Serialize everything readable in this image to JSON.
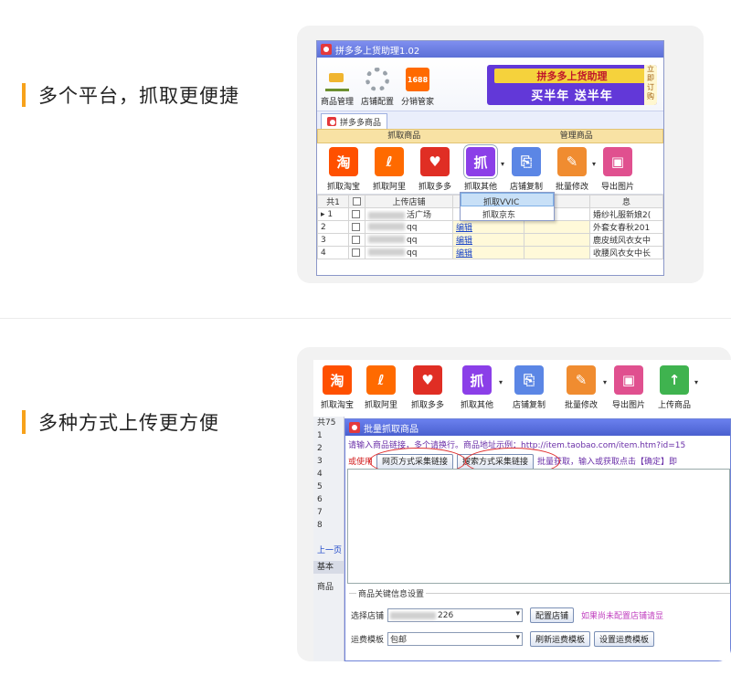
{
  "features": [
    {
      "text": "多个平台，抓取更便捷"
    },
    {
      "text": "多种方式上传更方便"
    }
  ],
  "window1": {
    "title": "拼多多上货助理1.02",
    "menu": [
      "商品管理",
      "店铺配置",
      "分销管家"
    ],
    "icon_1688": "1688",
    "banner": {
      "top": "拼多多上货助理",
      "bottom": "买半年  送半年",
      "side": "立即订购"
    },
    "tab": "拼多多商品",
    "groups": [
      "抓取商品",
      "管理商品"
    ],
    "ribbon": [
      {
        "label": "抓取淘宝",
        "glyph": "淘"
      },
      {
        "label": "抓取阿里",
        "glyph": "ℓ"
      },
      {
        "label": "抓取多多",
        "glyph": "♥"
      },
      {
        "label": "抓取其他",
        "glyph": "抓"
      },
      {
        "label": "店铺复制",
        "glyph": "⎘"
      },
      {
        "label": "批量修改",
        "glyph": "✎"
      },
      {
        "label": "导出图片",
        "glyph": "▣"
      }
    ],
    "dropdown": [
      "抓取VVIC",
      "抓取京东"
    ],
    "table": {
      "head": [
        "共1",
        "",
        "上传店铺",
        "",
        "",
        "息"
      ],
      "rows": [
        {
          "n": "1",
          "shop": "活广场",
          "edit": "",
          "title": "婚纱礼服新娘2("
        },
        {
          "n": "2",
          "shop": "qq",
          "edit": "编辑",
          "title": "外套女春秋201"
        },
        {
          "n": "3",
          "shop": "qq",
          "edit": "编辑",
          "title": "鹿皮绒风衣女中"
        },
        {
          "n": "4",
          "shop": "qq",
          "edit": "编辑",
          "title": "收腰风衣女中长"
        }
      ]
    }
  },
  "window2": {
    "ribbon": [
      {
        "label": "抓取淘宝",
        "glyph": "淘"
      },
      {
        "label": "抓取阿里",
        "glyph": "ℓ"
      },
      {
        "label": "抓取多多",
        "glyph": "♥"
      },
      {
        "label": "抓取其他",
        "glyph": "抓"
      },
      {
        "label": "店铺复制",
        "glyph": "⎘"
      },
      {
        "label": "批量修改",
        "glyph": "✎"
      },
      {
        "label": "导出图片",
        "glyph": "▣"
      },
      {
        "label": "上传商品",
        "glyph": "↑"
      }
    ],
    "side": [
      "共75",
      "1",
      "2",
      "3",
      "4",
      "5",
      "6",
      "7",
      "8"
    ],
    "side_prev": "上一页",
    "side_basic": "基本",
    "side_goods": "商品",
    "dialog": {
      "title": "批量抓取商品",
      "hint1": "请输入商品链接，多个请换行。商品地址示例：http://item.taobao.com/item.htm?id=15",
      "hint2_pre": "或使用",
      "btn_web": "网页方式采集链接",
      "btn_search": "搜索方式采集链接",
      "hint2_post": "批量获取，输入或获取点击【确定】即",
      "section": "商品关键信息设置",
      "shop_label": "选择店铺",
      "shop_value": "226",
      "config_btn": "配置店铺",
      "config_tip": "如果尚未配置店铺请显",
      "freight_label": "运费模板",
      "freight_value": "包邮",
      "refresh_btn": "刷新运费模板",
      "setup_btn": "设置运费模板"
    }
  }
}
